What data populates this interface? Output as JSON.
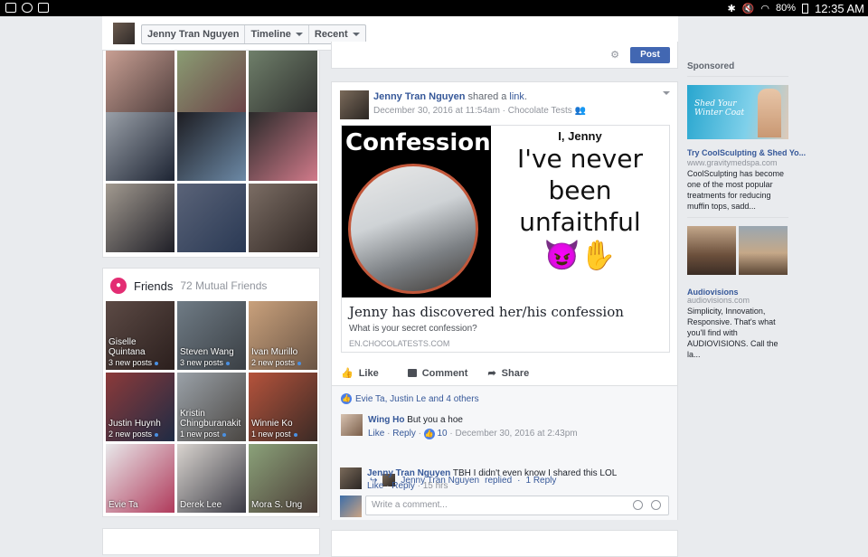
{
  "status_bar": {
    "battery": "80%",
    "time": "12:35 AM"
  },
  "name_bar": {
    "profile_name": "Jenny Tran Nguyen",
    "tabs": [
      {
        "label": "Timeline"
      },
      {
        "label": "Recent"
      }
    ]
  },
  "composer": {
    "post_label": "Post"
  },
  "friends_card": {
    "title": "Friends",
    "count": "72 Mutual Friends",
    "friends": [
      {
        "name": "Giselle Quintana",
        "posts": "3 new posts"
      },
      {
        "name": "Steven Wang",
        "posts": "3 new posts"
      },
      {
        "name": "Ivan Murillo",
        "posts": "2 new posts"
      },
      {
        "name": "Justin Huynh",
        "posts": "2 new posts"
      },
      {
        "name": "Kristin Chingburanakit",
        "posts": "1 new post"
      },
      {
        "name": "Winnie Ko",
        "posts": "1 new post"
      },
      {
        "name": "Evie Ta",
        "posts": ""
      },
      {
        "name": "Derek Lee",
        "posts": ""
      },
      {
        "name": "Mora S. Ung",
        "posts": ""
      }
    ]
  },
  "story": {
    "author": "Jenny Tran Nguyen",
    "action": "shared a",
    "link_word": "link",
    "date": "December 30, 2016 at 11:54am",
    "via": "Chocolate Tests",
    "link_card": {
      "image_confession": "Confession",
      "image_heading": "I, Jenny",
      "image_lines": [
        "I've never",
        "been",
        "unfaithful"
      ],
      "title": "Jenny has discovered her/his confession",
      "description": "What is your secret confession?",
      "domain": "EN.CHOCOLATESTS.COM"
    },
    "actions": {
      "like": "Like",
      "comment": "Comment",
      "share": "Share"
    },
    "likes_summary": "Evie Ta, Justin Le and 4 others",
    "comments": [
      {
        "author": "Wing Ho",
        "text": "But you a hoe",
        "like": "Like",
        "reply": "Reply",
        "reactions": "10",
        "time": "December 30, 2016 at 2:43pm"
      },
      {
        "author": "Jenny Tran Nguyen",
        "text": "TBH I didn't even know I shared this LOL",
        "like": "Like",
        "reply": "Reply",
        "time": "15 hrs"
      }
    ],
    "reply_summary": {
      "author": "Jenny Tran Nguyen",
      "verb": "replied",
      "count": "1 Reply"
    },
    "write_placeholder": "Write a comment..."
  },
  "sponsored": {
    "title": "Sponsored",
    "ads": [
      {
        "image_text": "Shed Your Winter Coat",
        "headline": "Try CoolSculpting & Shed Yo...",
        "url": "www.gravitymedspa.com",
        "body": "CoolSculpting has become one of the most popular treatments for reducing muffin tops, sadd..."
      },
      {
        "headline": "Audiovisions",
        "url": "audiovisions.com",
        "body": "Simplicity, Innovation, Responsive. That's what you'll find with AUDIOVISIONS. Call the la..."
      }
    ]
  },
  "colors": {
    "fb_blue": "#4267b2",
    "link_blue": "#365899",
    "friends_badge": "#e32d73"
  }
}
